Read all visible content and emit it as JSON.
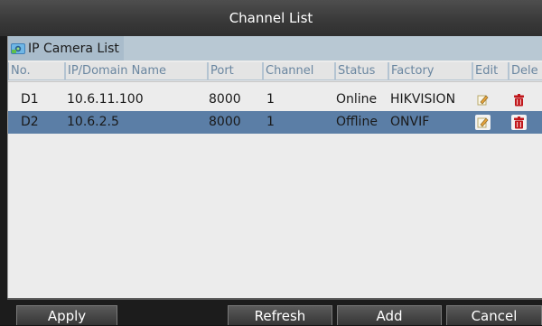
{
  "window": {
    "title": "Channel List"
  },
  "section": {
    "title": "IP Camera List",
    "icon": "camera-icon"
  },
  "table": {
    "columns": [
      "No.",
      "IP/Domain Name",
      "Port",
      "Channel",
      "Status",
      "Factory",
      "Edit",
      "Dele"
    ],
    "rows": [
      {
        "no": "D1",
        "ip": "10.6.11.100",
        "port": "8000",
        "channel": "1",
        "status": "Online",
        "factory": "HIKVISION",
        "selected": false
      },
      {
        "no": "D2",
        "ip": "10.6.2.5",
        "port": "8000",
        "channel": "1",
        "status": "Offline",
        "factory": "ONVIF",
        "selected": true
      }
    ]
  },
  "buttons": {
    "apply": "Apply",
    "refresh": "Refresh",
    "add": "Add",
    "cancel": "Cancel"
  },
  "colors": {
    "selected_row": "#5b7ea6",
    "header_text": "#6a86a0",
    "delete_icon": "#c0161b"
  }
}
